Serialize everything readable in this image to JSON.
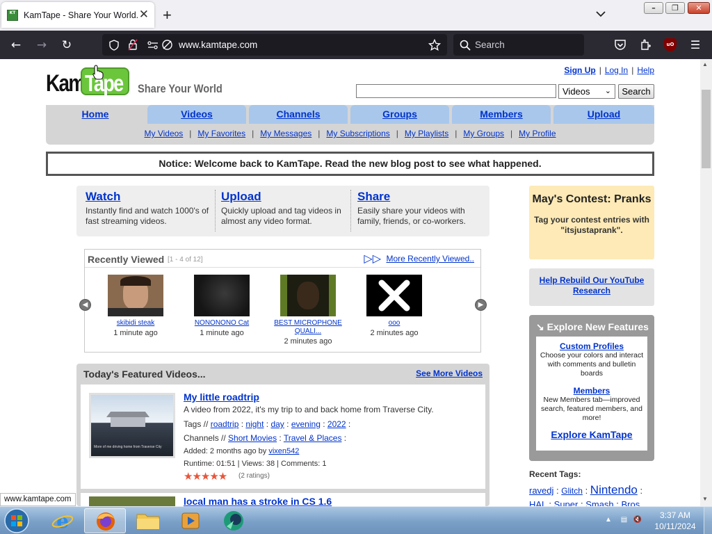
{
  "browser": {
    "tab_title": "KamTape - Share Your World.",
    "url": "www.kamtape.com",
    "search_placeholder": "Search",
    "status_url": "www.kamtape.com"
  },
  "site": {
    "logo_kam": "Kam",
    "logo_tape": "Tape",
    "tagline": "Share Your World",
    "top_links": {
      "signup": "Sign Up",
      "login": "Log In",
      "help": "Help"
    },
    "search": {
      "value": "",
      "select_value": "Videos",
      "button": "Search"
    },
    "nav_tabs": [
      "Home",
      "Videos",
      "Channels",
      "Groups",
      "Members",
      "Upload"
    ],
    "sub_nav": [
      "My Videos",
      "My Favorites",
      "My Messages",
      "My Subscriptions",
      "My Playlists",
      "My Groups",
      "My Profile"
    ],
    "notice": "Notice: Welcome back to KamTape. Read the new blog post to see what happened."
  },
  "intro": [
    {
      "title": "Watch",
      "text": "Instantly find and watch 1000's of fast streaming videos."
    },
    {
      "title": "Upload",
      "text": "Quickly upload and tag videos in almost any video format."
    },
    {
      "title": "Share",
      "text": "Easily share your videos with family, friends, or co-workers."
    }
  ],
  "recently_viewed": {
    "title": "Recently Viewed",
    "count": "[1 - 4 of 12]",
    "more": "More Recently Viewed..",
    "items": [
      {
        "name": "skibidi steak",
        "time": "1 minute ago"
      },
      {
        "name": "NONONONO Cat",
        "time": "1 minute ago"
      },
      {
        "name": "BEST MICROPHONE QUALI...",
        "time": "2 minutes ago"
      },
      {
        "name": "ooo",
        "time": "2 minutes ago"
      }
    ]
  },
  "featured": {
    "title": "Today's Featured Videos...",
    "more": "See More Videos",
    "video": {
      "title": "My little roadtrip",
      "description": "A video from 2022, it's my trip to and back home from Traverse City.",
      "thumb_caption": "More of me driving home from Traverse City",
      "tags_label": "Tags //",
      "tags": [
        "roadtrip",
        "night",
        "day",
        "evening",
        "2022"
      ],
      "channels_label": "Channels //",
      "channels": [
        "Short Movies",
        "Travel & Places"
      ],
      "added": "Added: 2 months ago by",
      "user": "vixen542",
      "stats": "Runtime: 01:51 | Views: 38 | Comments: 1",
      "rating_stars": 5,
      "ratings": "(2 ratings)"
    },
    "video2_title": "local man has a stroke in CS 1.6"
  },
  "sidebar": {
    "contest_title": "May's Contest: Pranks",
    "contest_text": "Tag your contest entries with \"itsjustaprank\".",
    "youtube_link": "Help Rebuild Our YouTube Research",
    "explore_title": "Explore New Features",
    "features": [
      {
        "title": "Custom Profiles",
        "text": "Choose your colors and interact with comments and bulletin boards"
      },
      {
        "title": "Members",
        "text": "New Members tab—improved search, featured members, and more!"
      }
    ],
    "explore_link": "Explore KamTape",
    "recent_tags_title": "Recent Tags:",
    "recent_tags_line1": [
      "ravedj",
      "Glitch",
      "Nintendo"
    ],
    "recent_tags_line2": [
      "HAL",
      "Super",
      "Smash",
      "Bros"
    ]
  },
  "taskbar": {
    "time": "3:37 AM",
    "date": "10/11/2024"
  }
}
